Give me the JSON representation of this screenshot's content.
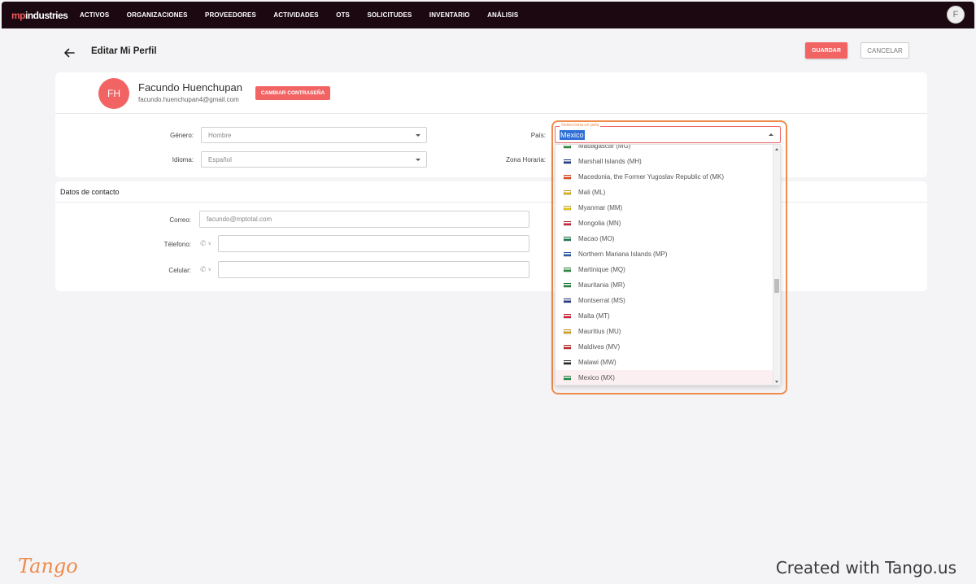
{
  "nav": {
    "logo_mp": "mp",
    "logo_rest": "industries",
    "items": [
      "ACTIVOS",
      "ORGANIZACIONES",
      "PROVEEDORES",
      "ACTIVIDADES",
      "OTS",
      "SOLICITUDES",
      "INVENTARIO",
      "ANÁLISIS"
    ],
    "user_initial": "F"
  },
  "header": {
    "title": "Editar Mi Perfil",
    "save_label": "GUARDAR",
    "cancel_label": "CANCELAR"
  },
  "profile": {
    "initials": "FH",
    "name": "Facundo Huenchupan",
    "email": "facundo.huenchupan4@gmail.com",
    "change_password_label": "CAMBIAR CONTRASEÑA",
    "genero_label": "Género:",
    "genero_value": "Hombre",
    "idioma_label": "Idioma:",
    "idioma_value": "Español",
    "pais_label": "País:",
    "zona_label": "Zona Horaria:"
  },
  "contact": {
    "title": "Datos de contacto",
    "correo_label": "Correo:",
    "correo_value": "facundo@mptotal.com",
    "telefono_label": "Télefono:",
    "celular_label": "Celular:"
  },
  "country_dropdown": {
    "legend": "Selecciona un país",
    "value": "Mexico",
    "options": [
      {
        "label": "Madagascar (MG)",
        "flag": "#2e8b3d"
      },
      {
        "label": "Marshall Islands (MH)",
        "flag": "#1f3d8a"
      },
      {
        "label": "Macedonia, the Former Yugoslav Republic of (MK)",
        "flag": "#e8471c"
      },
      {
        "label": "Mali (ML)",
        "flag": "#d8b21a"
      },
      {
        "label": "Myanmar (MM)",
        "flag": "#e6c21a"
      },
      {
        "label": "Mongolia (MN)",
        "flag": "#c8283b"
      },
      {
        "label": "Macao (MO)",
        "flag": "#1e7a4e"
      },
      {
        "label": "Northern Mariana Islands (MP)",
        "flag": "#2a5fb0"
      },
      {
        "label": "Martinique (MQ)",
        "flag": "#2f8c3f"
      },
      {
        "label": "Mauritania (MR)",
        "flag": "#1f8a3a"
      },
      {
        "label": "Montserrat (MS)",
        "flag": "#233a86"
      },
      {
        "label": "Malta (MT)",
        "flag": "#d9213a"
      },
      {
        "label": "Mauritius (MU)",
        "flag": "#d9a31a"
      },
      {
        "label": "Maldives (MV)",
        "flag": "#c42a2a"
      },
      {
        "label": "Malawi (MW)",
        "flag": "#2a2a2a"
      },
      {
        "label": "Mexico (MX)",
        "flag": "#1c8a47"
      }
    ],
    "active_index": 15
  },
  "footer": {
    "logo": "Tango",
    "credit": "Created with Tango.us"
  }
}
